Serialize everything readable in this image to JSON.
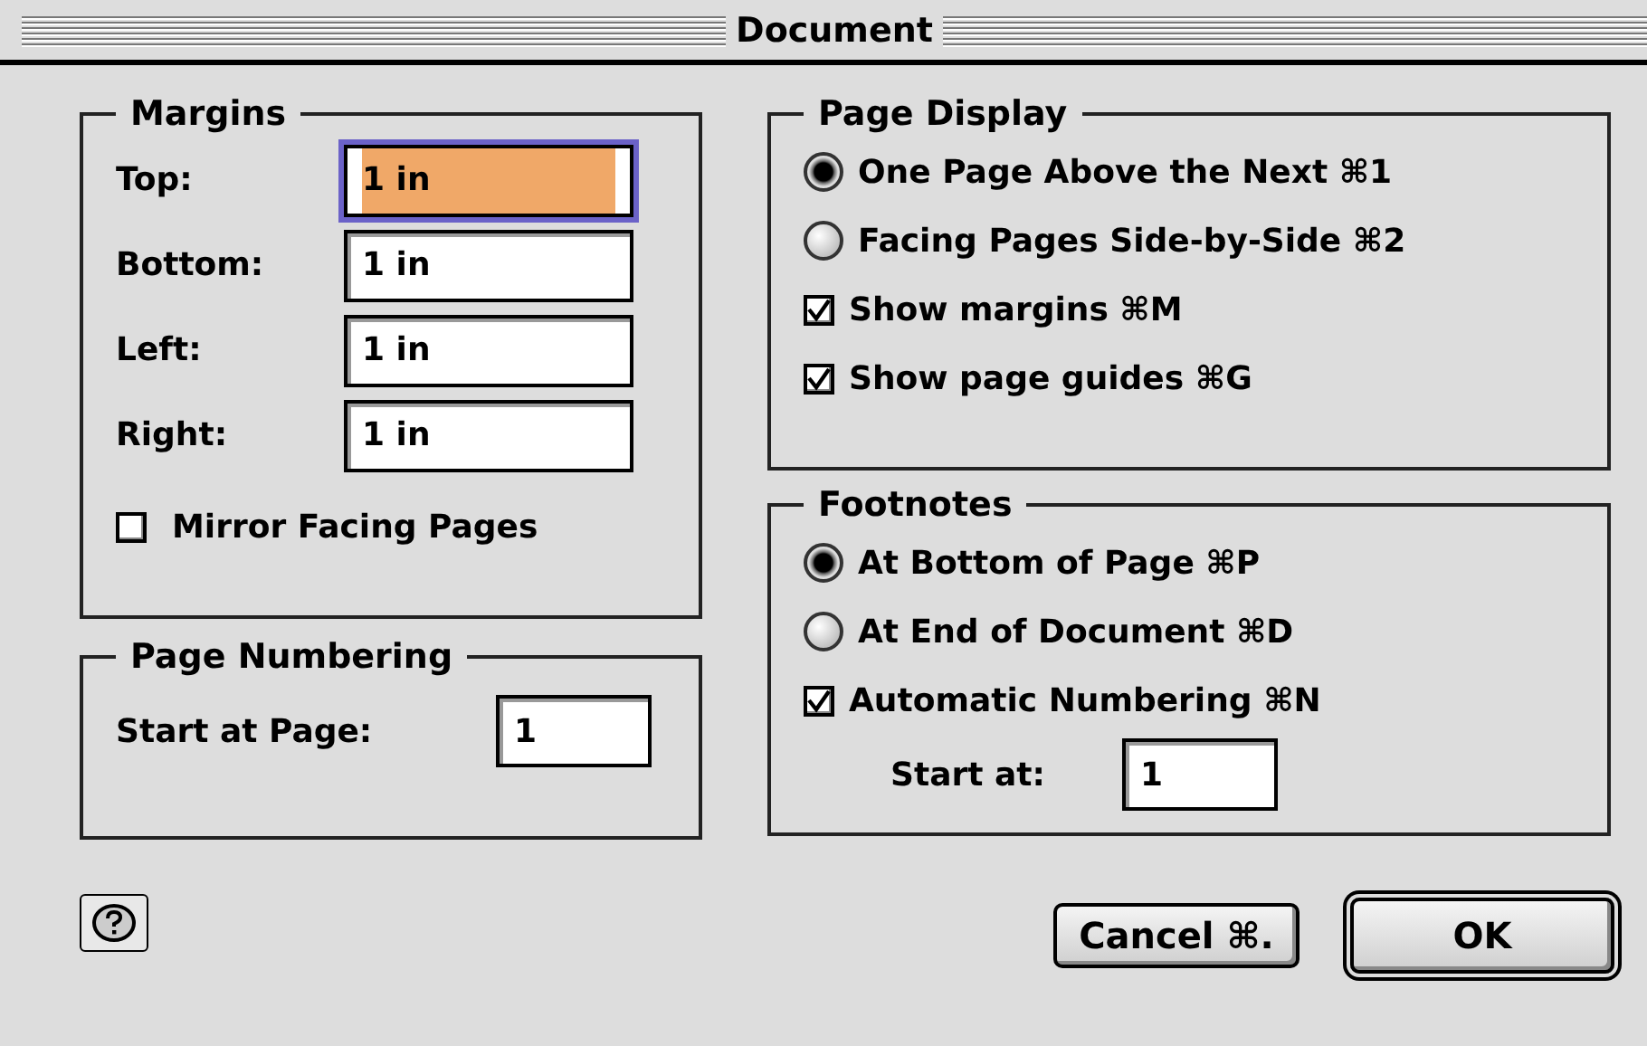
{
  "window": {
    "title": "Document"
  },
  "margins": {
    "title": "Margins",
    "fields": [
      {
        "label": "Top:",
        "value": "1 in",
        "focused": true
      },
      {
        "label": "Bottom:",
        "value": "1 in",
        "focused": false
      },
      {
        "label": "Left:",
        "value": "1 in",
        "focused": false
      },
      {
        "label": "Right:",
        "value": "1 in",
        "focused": false
      }
    ],
    "mirror": {
      "label": "Mirror Facing Pages",
      "checked": false
    }
  },
  "page_numbering": {
    "title": "Page Numbering",
    "label": "Start at Page:",
    "value": "1"
  },
  "page_display": {
    "title": "Page Display",
    "options": [
      {
        "kind": "radio",
        "label": "One Page Above the Next ⌘1",
        "selected": true
      },
      {
        "kind": "radio",
        "label": "Facing Pages Side-by-Side ⌘2",
        "selected": false
      },
      {
        "kind": "checkbox",
        "label": "Show margins ⌘M",
        "checked": true
      },
      {
        "kind": "checkbox",
        "label": "Show page guides ⌘G",
        "checked": true
      }
    ]
  },
  "footnotes": {
    "title": "Footnotes",
    "options": [
      {
        "kind": "radio",
        "label": "At Bottom of Page ⌘P",
        "selected": true
      },
      {
        "kind": "radio",
        "label": "At End of Document ⌘D",
        "selected": false
      },
      {
        "kind": "checkbox",
        "label": "Automatic Numbering ⌘N",
        "checked": true
      }
    ],
    "start": {
      "label": "Start at:",
      "value": "1"
    }
  },
  "buttons": [
    {
      "label": "Cancel ⌘.",
      "default": false
    },
    {
      "label": "OK",
      "default": true
    }
  ]
}
